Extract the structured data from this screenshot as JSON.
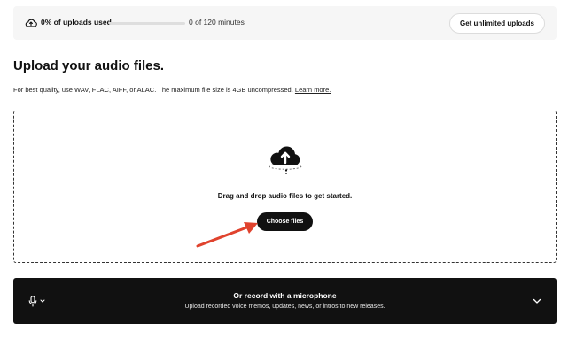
{
  "usage": {
    "label": "0% of uploads used",
    "progress_fraction": 0,
    "minutes": "0 of 120 minutes",
    "upgrade_label": "Get unlimited uploads"
  },
  "upload": {
    "title": "Upload your audio files.",
    "description": "For best quality, use WAV, FLAC, AIFF, or ALAC. The maximum file size is 4GB uncompressed.",
    "learn_more": "Learn more.",
    "dropzone_text": "Drag and drop audio files to get started.",
    "choose_label": "Choose files",
    "icon": "cloud-upload-icon"
  },
  "record": {
    "title": "Or record with a microphone",
    "subtitle": "Upload recorded voice memos, updates, news, or intros to new releases.",
    "mic_icon": "microphone-icon",
    "expand_icon": "chevron-down-icon"
  },
  "colors": {
    "dark": "#111111",
    "annotation_arrow": "#e0432e",
    "usage_background": "#f6f6f6"
  }
}
